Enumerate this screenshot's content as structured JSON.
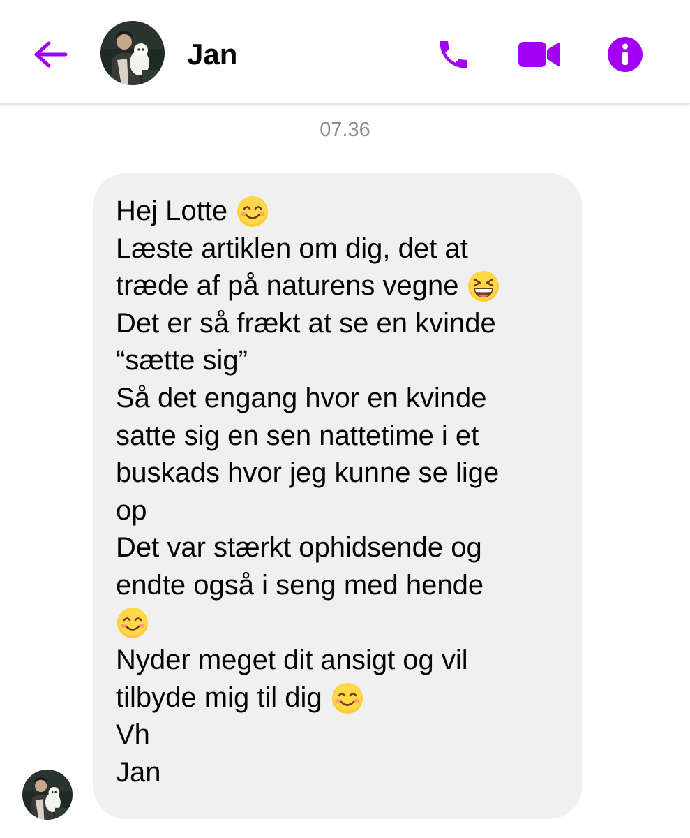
{
  "header": {
    "contact_name": "Jan",
    "icons": {
      "back": "back-arrow-icon",
      "call": "phone-icon",
      "video": "video-camera-icon",
      "info": "info-icon"
    },
    "accent_color": "#a100f2"
  },
  "thread": {
    "timestamp": "07.36",
    "message": {
      "lines": [
        {
          "text": "Hej Lotte",
          "emoji": "smiling-face-icon"
        },
        {
          "text": "Læste artiklen om dig, det at",
          "emoji": null
        },
        {
          "text": "træde af på naturens vegne",
          "emoji": "grinning-squinting-face-icon"
        },
        {
          "text": "Det er så frækt at se en kvinde",
          "emoji": null
        },
        {
          "text": "“sætte sig”",
          "emoji": null
        },
        {
          "text": "Så det engang hvor en kvinde",
          "emoji": null
        },
        {
          "text": "satte sig en sen nattetime i et",
          "emoji": null
        },
        {
          "text": "buskads hvor jeg kunne se lige",
          "emoji": null
        },
        {
          "text": "op",
          "emoji": null
        },
        {
          "text": "Det var stærkt ophidsende og",
          "emoji": null
        },
        {
          "text": "endte også i seng med hende",
          "emoji": null
        },
        {
          "text": "",
          "emoji": "smiling-face-icon"
        },
        {
          "text": "Nyder meget dit ansigt og vil",
          "emoji": null
        },
        {
          "text": "tilbyde mig til dig",
          "emoji": "smiling-face-icon"
        },
        {
          "text": "Vh",
          "emoji": null
        },
        {
          "text": "Jan",
          "emoji": null
        }
      ]
    },
    "bubble_color": "#f0f0f0"
  }
}
